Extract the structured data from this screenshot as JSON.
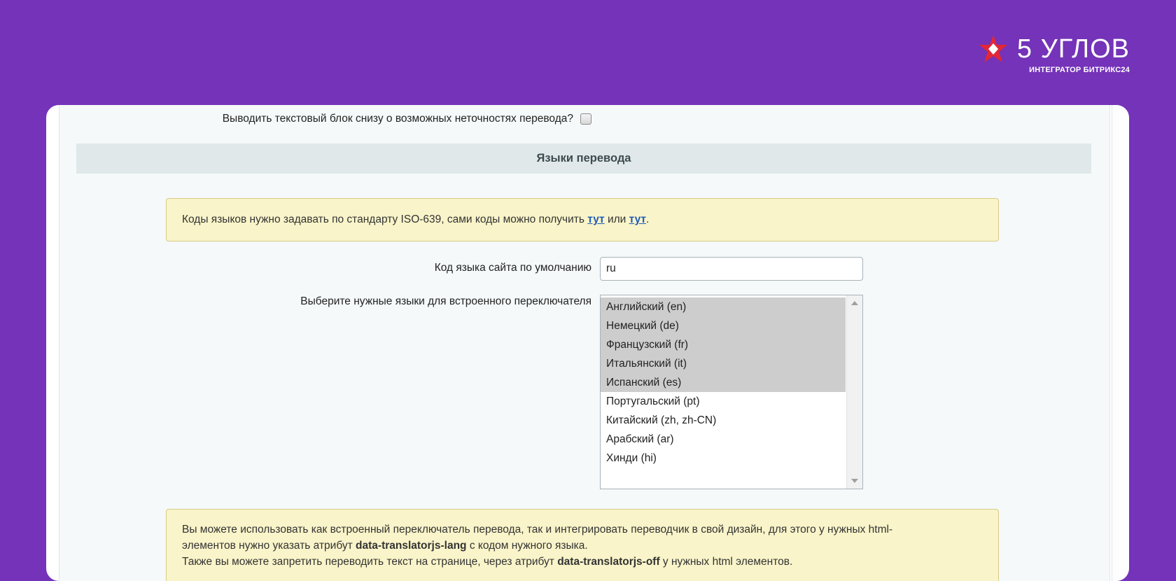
{
  "brand": {
    "name": "5 УГЛОВ",
    "tagline": "ИНТЕГРАТОР БИТРИКС24",
    "colors": {
      "background": "#7433b8",
      "star": "#e32636"
    }
  },
  "form": {
    "bottom_notice_checkbox": {
      "label": "Выводить текстовый блок снизу о возможных неточностях перевода?",
      "checked": false
    },
    "section_title": "Языки перевода",
    "iso_note": {
      "text_before": "Коды языков нужно задавать по стандарту ISO-639, сами коды можно получить ",
      "link1": "тут",
      "middle": " или ",
      "link2": "тут",
      "after": "."
    },
    "default_lang": {
      "label": "Код языка сайта по умолчанию",
      "value": "ru"
    },
    "switcher_languages": {
      "label": "Выберите нужные языки для встроенного переключателя",
      "options": [
        {
          "label": "Английский (en)",
          "selected": true
        },
        {
          "label": "Немецкий (de)",
          "selected": true
        },
        {
          "label": "Французский (fr)",
          "selected": true
        },
        {
          "label": "Итальянский (it)",
          "selected": true
        },
        {
          "label": "Испанский (es)",
          "selected": true
        },
        {
          "label": "Португальский (pt)",
          "selected": false
        },
        {
          "label": "Китайский (zh, zh-CN)",
          "selected": false
        },
        {
          "label": "Арабский (ar)",
          "selected": false
        },
        {
          "label": "Хинди (hi)",
          "selected": false
        }
      ]
    },
    "integration_note": {
      "line1": "Вы можете использовать как встроенный переключатель перевода, так и интегрировать переводчик в свой дизайн, для этого у нужных html-",
      "line2_before": "элементов нужно указать атрибут ",
      "line2_attr": "data-translatorjs-lang",
      "line2_after": " с кодом нужного языка.",
      "line3_before": "Также вы можете запретить переводить текст на странице, через атрибут ",
      "line3_attr": "data-translatorjs-off",
      "line3_after": " у нужных html элементов."
    }
  }
}
